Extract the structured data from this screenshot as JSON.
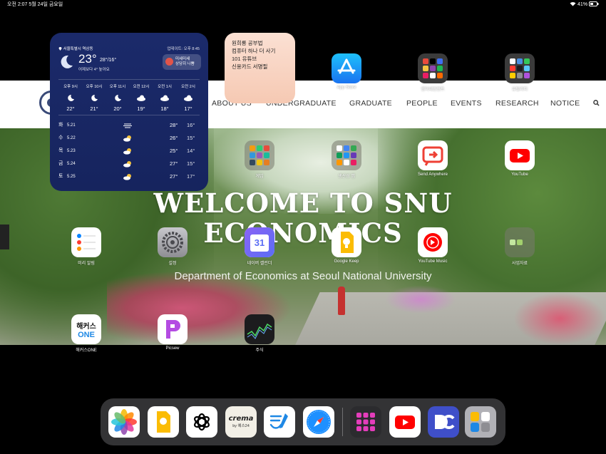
{
  "status_bar": {
    "left": "오전 2:07   5월 24일 금요일",
    "right": "41%"
  },
  "website": {
    "nav_items": [
      "ABOUT US",
      "UNDERGRADUATE",
      "GRADUATE",
      "PEOPLE",
      "EVENTS",
      "RESEARCH",
      "NOTICE"
    ],
    "hero_title_line1": "WELCOME TO SNU",
    "hero_title_line2": "ECONOMICS",
    "hero_subtitle": "Department of Economics at Seoul National University"
  },
  "weather": {
    "location": "서울특별시 역삼동",
    "updated": "업데이트: 오후 8:45",
    "current_temp": "23°",
    "hi_lo": "28°/16°",
    "comparison": "어제보다 4° 높아요",
    "air_quality_line1": "미세미세",
    "air_quality_line2": "상당히 나쁨",
    "hourly": [
      {
        "time": "오후 9시",
        "temp": "22°",
        "icon": "moon-icon"
      },
      {
        "time": "오후 10시",
        "temp": "21°",
        "icon": "moon-icon"
      },
      {
        "time": "오후 11시",
        "temp": "20°",
        "icon": "moon-icon"
      },
      {
        "time": "오전 12시",
        "temp": "19°",
        "icon": "cloud-night-icon"
      },
      {
        "time": "오전 1시",
        "temp": "18°",
        "icon": "cloud-night-icon"
      },
      {
        "time": "오전 2시",
        "temp": "17°",
        "icon": "cloud-night-icon"
      }
    ],
    "daily": [
      {
        "day": "화",
        "date": "5.21",
        "icon": "fog-icon",
        "high": "28°",
        "low": "16°"
      },
      {
        "day": "수",
        "date": "5.22",
        "icon": "partly-sunny-icon",
        "high": "26°",
        "low": "15°"
      },
      {
        "day": "목",
        "date": "5.23",
        "icon": "partly-sunny-icon",
        "high": "25°",
        "low": "14°"
      },
      {
        "day": "금",
        "date": "5.24",
        "icon": "partly-sunny-icon",
        "high": "27°",
        "low": "15°"
      },
      {
        "day": "토",
        "date": "5.25",
        "icon": "partly-sunny-icon",
        "high": "27°",
        "low": "17°"
      }
    ]
  },
  "note": {
    "lines": [
      "원희룡 공부법",
      "컴퓨터 하나 더 사기",
      "101 유튜브",
      "신용카드 서명필"
    ]
  },
  "apps": {
    "app_store": "App Store",
    "entertainment": "엔터테인먼트",
    "utility": "유틸리티",
    "games": "게임",
    "productivity": "생산성 앱",
    "send_anywhere": "Send Anywhere",
    "youtube": "YouTube",
    "reminders": "미리 알림",
    "settings": "설정",
    "naver_calendar": "네이버 캘린더",
    "google_keep": "Google Keep",
    "youtube_music": "YouTube Music",
    "reference": "사업자료",
    "hackers_one": "해커스ONE",
    "picsew": "Picsew",
    "stocks": "주식",
    "hackers_line1": "해커스",
    "hackers_line2": "ONE",
    "calendar_day": "31",
    "crema_line1": "crema",
    "crema_line2": "by 예스24"
  },
  "colors": {
    "weather_bg": "#16245e",
    "note_bg": "#f6c9b3",
    "dock_bg": "#37373a"
  }
}
